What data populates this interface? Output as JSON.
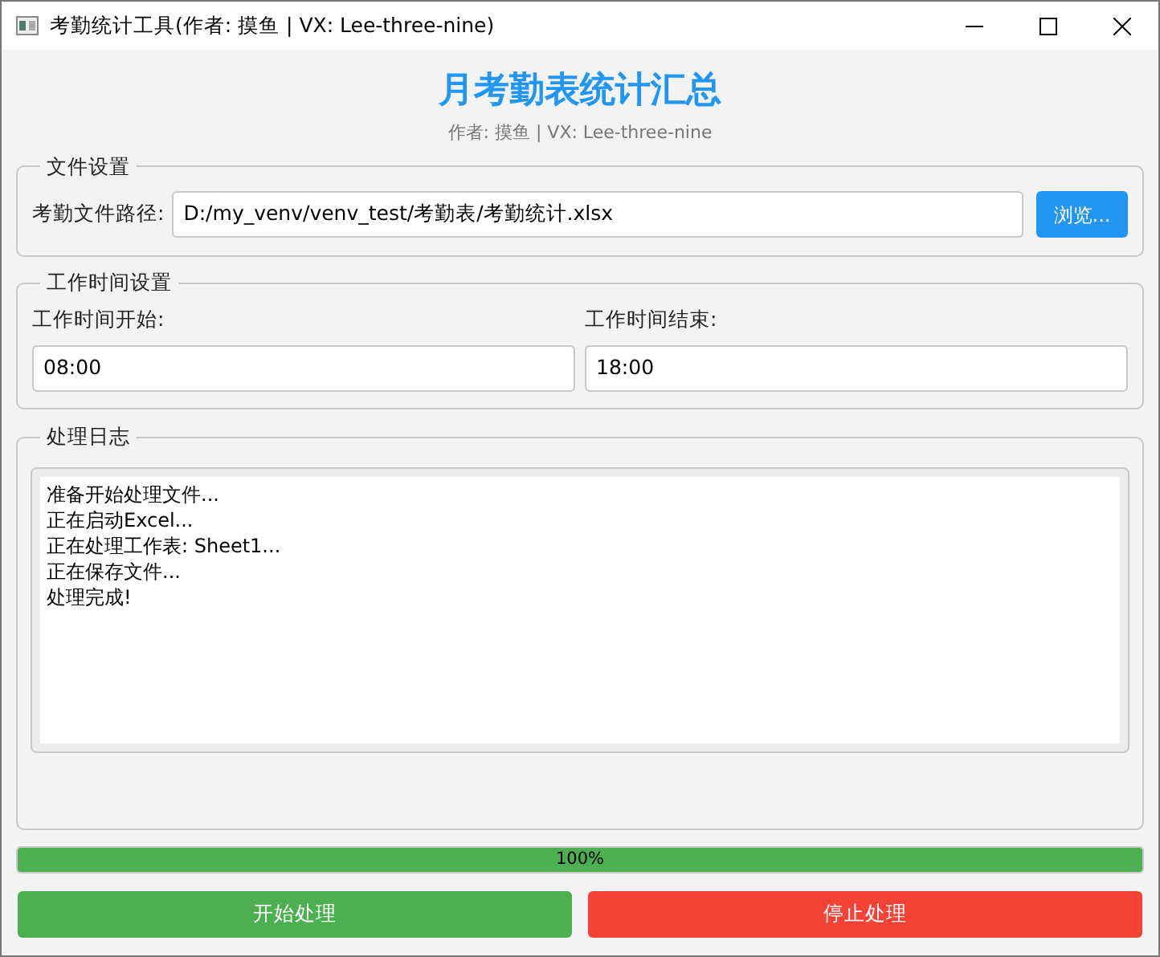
{
  "window": {
    "title": "考勤统计工具(作者: 摸鱼 | VX: Lee-three-nine)"
  },
  "header": {
    "title": "月考勤表统计汇总",
    "subtitle": "作者: 摸鱼 | VX: Lee-three-nine"
  },
  "file_settings": {
    "legend": "文件设置",
    "label": "考勤文件路径:",
    "value": "D:/my_venv/venv_test/考勤表/考勤统计.xlsx",
    "button": "浏览..."
  },
  "time_settings": {
    "legend": "工作时间设置",
    "fields": [
      {
        "label": "工作时间开始:",
        "value": "08:00"
      },
      {
        "label": "工作时间结束:",
        "value": "18:00"
      }
    ]
  },
  "log": {
    "legend": "处理日志",
    "lines": [
      "准备开始处理文件...",
      "正在启动Excel...",
      "正在处理工作表: Sheet1...",
      "正在保存文件...",
      "处理完成!"
    ]
  },
  "progress": {
    "level": 1,
    "reading": "100%"
  },
  "buttons": [
    {
      "label": "开始处理",
      "kind": "start"
    },
    {
      "label": "停止处理",
      "kind": "stop"
    }
  ]
}
